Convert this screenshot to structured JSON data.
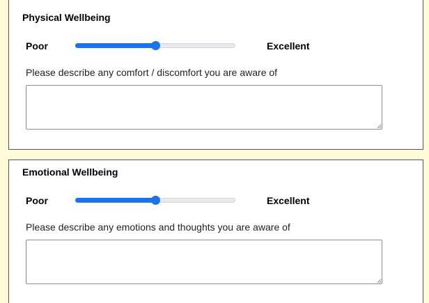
{
  "sections": [
    {
      "title": "Physical Wellbeing",
      "slider": {
        "low_label": "Poor",
        "high_label": "Excellent",
        "value_fraction": 0.5
      },
      "prompt": "Please describe any comfort / discomfort you are aware of",
      "textarea_value": ""
    },
    {
      "title": "Emotional Wellbeing",
      "slider": {
        "low_label": "Poor",
        "high_label": "Excellent",
        "value_fraction": 0.5
      },
      "prompt": "Please describe any emotions and thoughts you are aware of",
      "textarea_value": ""
    }
  ],
  "colors": {
    "page_background": "#fdfbd8",
    "slider_accent": "#1a73e8",
    "card_border": "#555555"
  }
}
